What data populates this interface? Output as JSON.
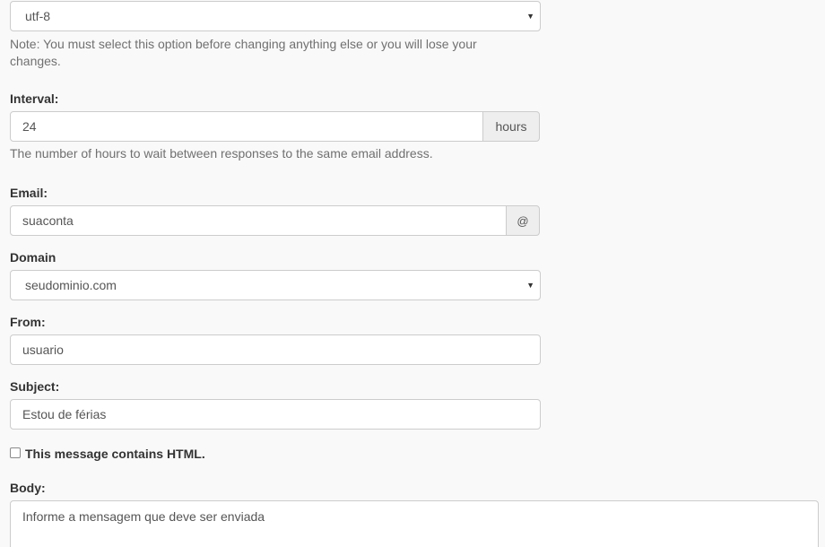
{
  "charset": {
    "selected": "utf-8",
    "note": "Note: You must select this option before changing anything else or you will lose your changes."
  },
  "interval": {
    "label": "Interval:",
    "value": "24",
    "unit": "hours",
    "help": "The number of hours to wait between responses to the same email address."
  },
  "email": {
    "label": "Email:",
    "value": "suaconta",
    "addon": "@"
  },
  "domain": {
    "label": "Domain",
    "selected": "seudominio.com"
  },
  "from": {
    "label": "From:",
    "value": "usuario"
  },
  "subject": {
    "label": "Subject:",
    "value": "Estou de férias"
  },
  "html_option": {
    "label": "This message contains HTML.",
    "checked": false
  },
  "body": {
    "label": "Body:",
    "value": "Informe a mensagem que deve ser enviada"
  }
}
